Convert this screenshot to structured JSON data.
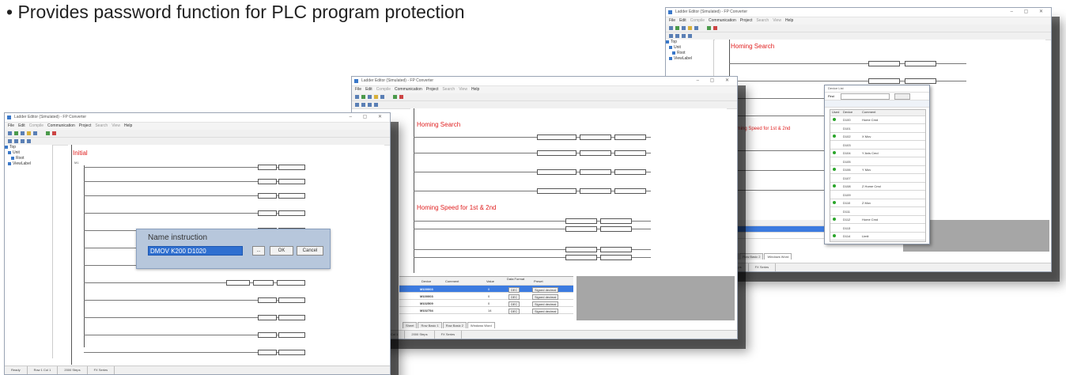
{
  "headline": "• Provides password function for PLC program protection",
  "window_common": {
    "title": "Ladder Editor (Simulated) - FP Converter",
    "menus": [
      "File",
      "Edit",
      "Compile",
      "Communication",
      "Project",
      "Search",
      "View",
      "Help"
    ],
    "tree": [
      "Top",
      "Unit",
      "Root",
      "ViewLabel"
    ],
    "status": [
      "Ready",
      "Row 1 Col 1",
      "2000 Steps",
      "FX Series"
    ]
  },
  "window1": {
    "section": "Initial",
    "dialog": {
      "title": "Name instruction",
      "input_value": "DMOV K200 D1020",
      "ok_label": "OK",
      "cancel_label": "Cancel",
      "dots_label": "..."
    }
  },
  "window2": {
    "section1": "Homing Search",
    "section2": "Homing Speed for 1st & 2nd",
    "grid_headers": [
      "Device",
      "Comment",
      "Value",
      "Data Format",
      "Preset"
    ],
    "grid_rows": [
      {
        "device": "M100003",
        "value": "0",
        "format": "DEC",
        "preset": "Signed decimal"
      },
      {
        "device": "M100003",
        "value": "0",
        "format": "DEC",
        "preset": "Signed decimal"
      },
      {
        "device": "M102509",
        "value": "0",
        "format": "DEC",
        "preset": "Signed decimal"
      },
      {
        "device": "M102754",
        "value": "14",
        "format": "DEC",
        "preset": "Signed decimal"
      }
    ],
    "tabs": [
      "Sheet",
      "Row Basic 1",
      "Row Basic 2",
      "Windows Word"
    ]
  },
  "window3": {
    "section1": "Homing Search",
    "section2": "Homing Speed for 1st & 2nd",
    "popup": {
      "title": "Device List",
      "search_label": "Find",
      "columns": [
        "Used",
        "Device",
        "Comment"
      ],
      "rows": [
        {
          "device": "D100",
          "comment": "Home Cmd"
        },
        {
          "device": "D101",
          "comment": ""
        },
        {
          "device": "D102",
          "comment": "X Mov"
        },
        {
          "device": "D103",
          "comment": ""
        },
        {
          "device": "D104",
          "comment": "Y Axis Cmd"
        },
        {
          "device": "D105",
          "comment": ""
        },
        {
          "device": "D106",
          "comment": "Y Mov"
        },
        {
          "device": "D107",
          "comment": ""
        },
        {
          "device": "D108",
          "comment": "Z Home Cmd"
        },
        {
          "device": "D109",
          "comment": ""
        },
        {
          "device": "D110",
          "comment": "Z Mov"
        },
        {
          "device": "D111",
          "comment": ""
        },
        {
          "device": "D112",
          "comment": "Home Cmd"
        },
        {
          "device": "D113",
          "comment": ""
        },
        {
          "device": "D114",
          "comment": "Limit"
        }
      ]
    },
    "grid_rows": [
      {
        "device": "M100003",
        "format": "DEC",
        "preset": "Signed decimal"
      },
      {
        "device": "M102509",
        "format": "DEC",
        "preset": "Signed decimal"
      }
    ],
    "tabs": [
      "Row Basic 1",
      "Row Basic 2",
      "Windows Word"
    ]
  }
}
